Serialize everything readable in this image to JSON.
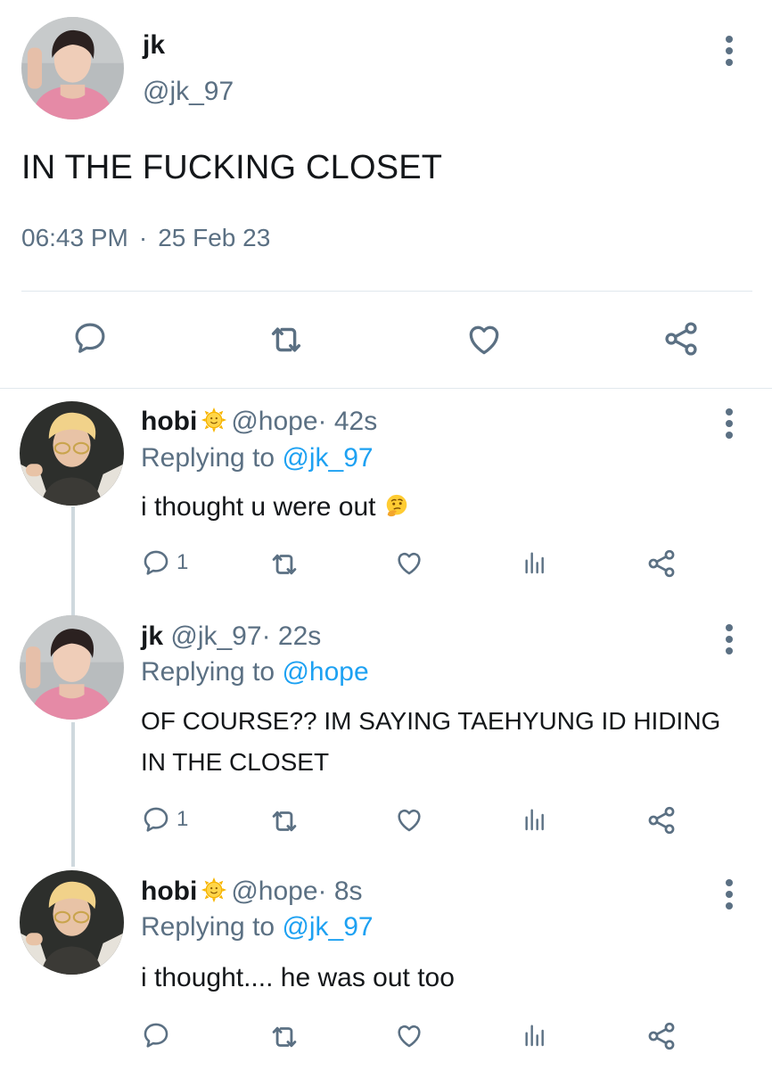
{
  "main_tweet": {
    "name": "jk",
    "handle": "@jk_97",
    "text": "IN THE FUCKING CLOSET",
    "time": "06:43 PM",
    "separator": "·",
    "date": "25 Feb 23",
    "icons": [
      "reply-icon",
      "retweet-icon",
      "like-icon",
      "share-icon"
    ]
  },
  "replies": [
    {
      "name": "hobi",
      "name_emoji": "sun-with-face",
      "handle": "@hope",
      "age": "· 42s",
      "replying_prefix": "Replying to",
      "replying_to": "@jk_97",
      "text": "i thought u were out",
      "text_emoji": "thinking-face",
      "reply_count": "1"
    },
    {
      "name": "jk",
      "handle": "@jk_97",
      "age": "· 22s",
      "replying_prefix": "Replying to",
      "replying_to": "@hope",
      "text_line1": "OF COURSE?? IM SAYING TAEHYUNG ID HIDING",
      "text_line2": "IN THE CLOSET",
      "reply_count": "1"
    },
    {
      "name": "hobi",
      "name_emoji": "sun-with-face",
      "handle": "@hope",
      "age": "· 8s",
      "replying_prefix": "Replying to",
      "replying_to": "@jk_97",
      "text": "i thought.... he was out too",
      "reply_count": ""
    }
  ],
  "colors": {
    "text": "#14171a",
    "muted": "#5b7083",
    "link": "#1da1f2",
    "divider": "#e1e8ed",
    "thread_line": "#cfd9de"
  }
}
